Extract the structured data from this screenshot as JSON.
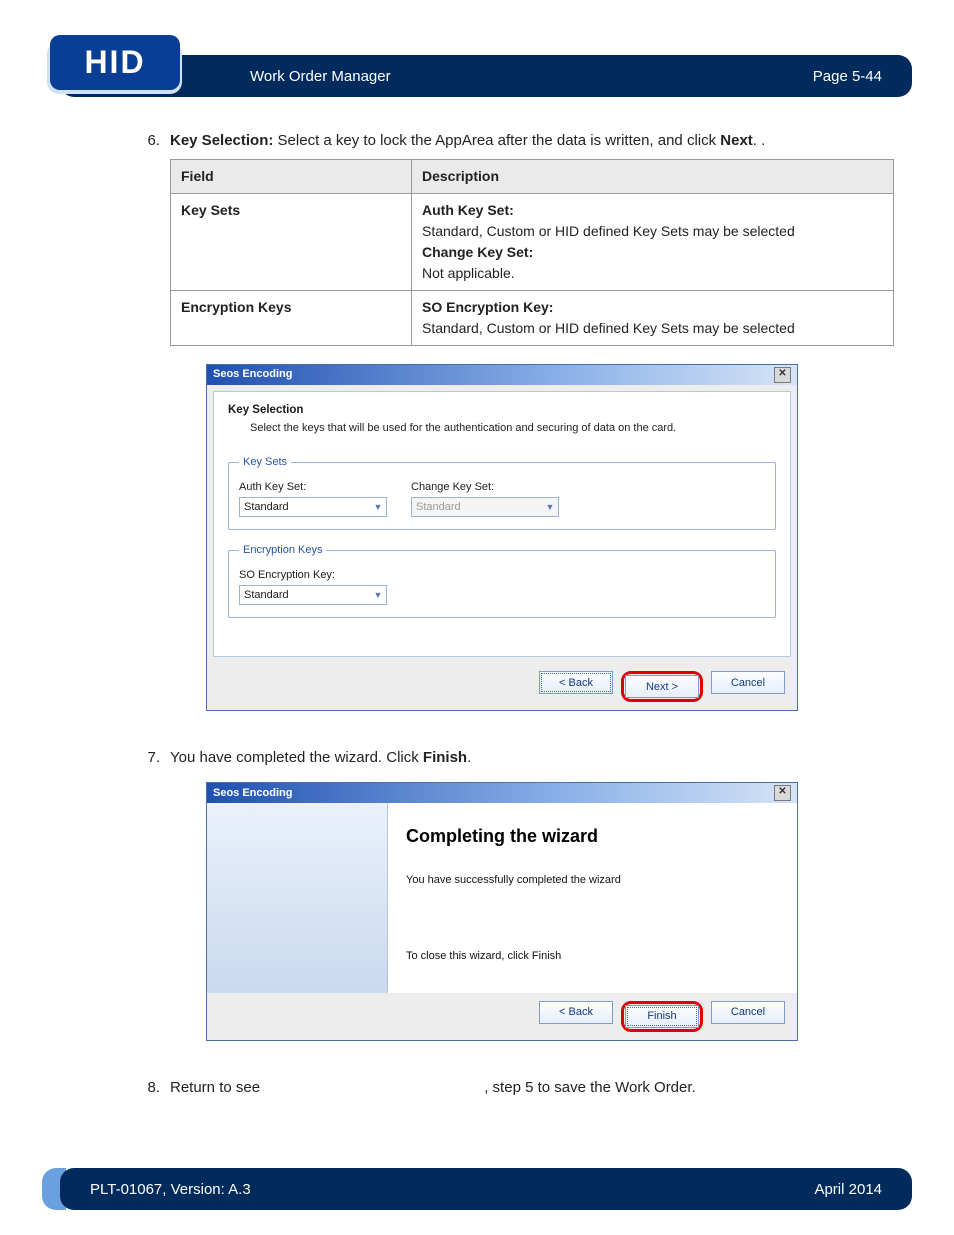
{
  "header": {
    "logo_text": "HID",
    "title": "Work Order Manager",
    "page_label": "Page 5-44"
  },
  "footer": {
    "doc_id": "PLT-01067, Version: A.3",
    "date": "April 2014"
  },
  "step6": {
    "num": "6.",
    "prefix": "Key Selection:",
    "text_a": " Select a key to lock the AppArea after the data is written, and click ",
    "bold_next": "Next",
    "text_b": ". ."
  },
  "table": {
    "h1": "Field",
    "h2": "Description",
    "r1c1": "Key Sets",
    "r1_auth_b": "Auth Key Set:",
    "r1_auth_t": " Standard, Custom or HID defined Key Sets may be selected",
    "r1_chg_b": "Change Key Set:",
    "r1_chg_t": " Not applicable.",
    "r2c1": "Encryption Keys",
    "r2_so_b": "SO Encryption Key:",
    "r2_so_t": " Standard, Custom or HID defined Key Sets may be selected"
  },
  "dlg1": {
    "title": "Seos Encoding",
    "head": "Key Selection",
    "sub": "Select the keys that will be used for the authentication and securing of data on the card.",
    "grp_keysets": "Key Sets",
    "auth_label": "Auth Key Set:",
    "auth_value": "Standard",
    "chg_label": "Change Key Set:",
    "chg_value": "Standard",
    "grp_enc": "Encryption Keys",
    "so_label": "SO Encryption Key:",
    "so_value": "Standard",
    "btn_back": "< Back",
    "btn_next": "Next >",
    "btn_cancel": "Cancel"
  },
  "step7": {
    "num": "7.",
    "text_a": "You have completed the wizard. Click ",
    "bold_finish": "Finish",
    "text_b": "."
  },
  "dlg2": {
    "title": "Seos Encoding",
    "heading": "Completing the wizard",
    "line1": "You have successfully completed the wizard",
    "line2": "To close this wizard, click Finish",
    "btn_back": "< Back",
    "btn_finish": "Finish",
    "btn_cancel": "Cancel"
  },
  "step8": {
    "num": "8.",
    "text_a": "Return to see ",
    "link": "",
    "text_b": ", step 5 to save the Work Order."
  }
}
